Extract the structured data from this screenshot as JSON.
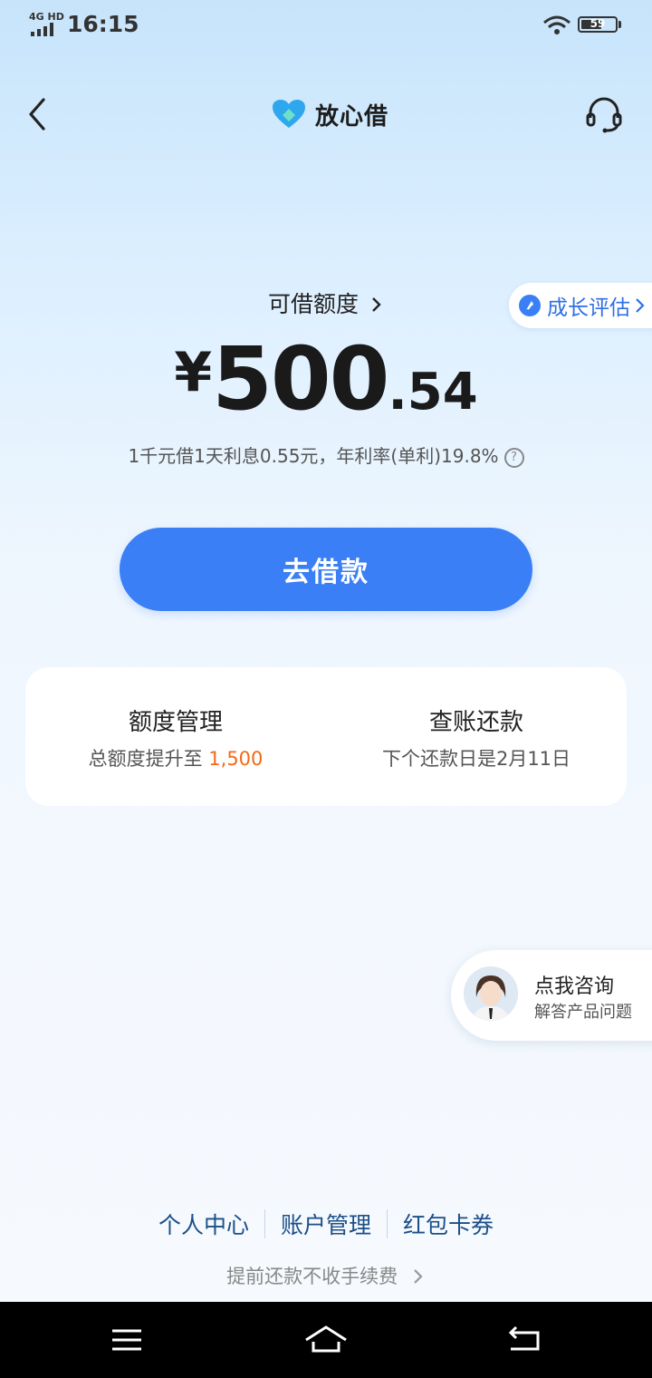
{
  "status_bar": {
    "network": "4G HD",
    "time": "16:15",
    "battery": "59"
  },
  "header": {
    "app_name": "放心借"
  },
  "credit": {
    "label": "可借额度",
    "currency": "¥",
    "amount_integer": "500",
    "amount_decimal": ".54",
    "rate_text": "1千元借1天利息0.55元，年利率(单利)19.8%",
    "growth_label": "成长评估"
  },
  "borrow_button": {
    "label": "去借款"
  },
  "cards": [
    {
      "title": "额度管理",
      "sub_prefix": "总额度提升至 ",
      "sub_highlight": "1,500"
    },
    {
      "title": "查账还款",
      "sub_prefix": "下个还款日是2月11日",
      "sub_highlight": ""
    }
  ],
  "consult": {
    "title": "点我咨询",
    "subtitle": "解答产品问题"
  },
  "footer": {
    "links": [
      "个人中心",
      "账户管理",
      "红包卡券"
    ],
    "prepay": "提前还款不收手续费"
  },
  "colors": {
    "primary": "#3a7ff6",
    "highlight": "#f26a14",
    "link": "#1b4f8a"
  },
  "icons": [
    "back-icon",
    "logo-icon",
    "headset-icon",
    "growth-icon",
    "help-icon",
    "chevron-right-icon",
    "menu-icon",
    "home-icon",
    "return-icon"
  ]
}
